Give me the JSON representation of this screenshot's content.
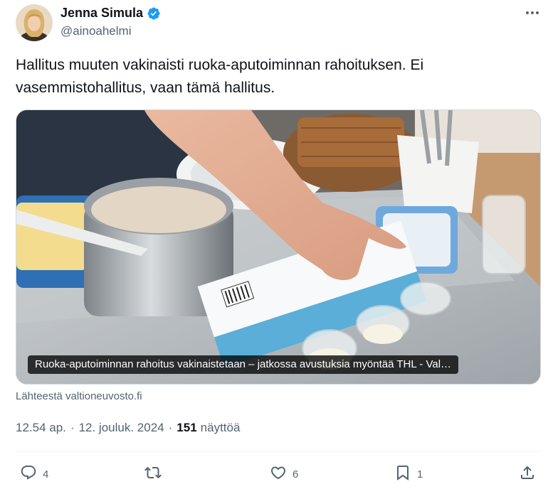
{
  "author": {
    "display_name": "Jenna Simula",
    "handle": "@ainoahelmi",
    "verified": true
  },
  "tweet": {
    "text": "Hallitus muuten vakinaisti ruoka-aputoiminnan rahoituksen. Ei vasemmistohallitus, vaan tämä hallitus."
  },
  "card": {
    "caption": "Ruoka-aputoiminnan rahoitus vakinaistetaan – jatkossa avustuksia myöntää THL - Val…",
    "source": "Lähteestä valtioneuvosto.fi"
  },
  "meta": {
    "time": "12.54 ap.",
    "separator1": "·",
    "date": "12. jouluk. 2024",
    "separator2": "·",
    "views_count": "151",
    "views_label": "näyttöä"
  },
  "actions": {
    "replies": "4",
    "reposts": "",
    "likes": "6",
    "bookmarks": "1"
  },
  "icons": {
    "verified": "verified-badge-icon",
    "more": "more-icon",
    "reply": "reply-icon",
    "repost": "repost-icon",
    "like": "heart-icon",
    "bookmark": "bookmark-icon",
    "share": "share-icon"
  },
  "colors": {
    "text_primary": "#0f1419",
    "text_secondary": "#536471",
    "verified_blue": "#1d9bf0",
    "border": "#cfd9de"
  }
}
